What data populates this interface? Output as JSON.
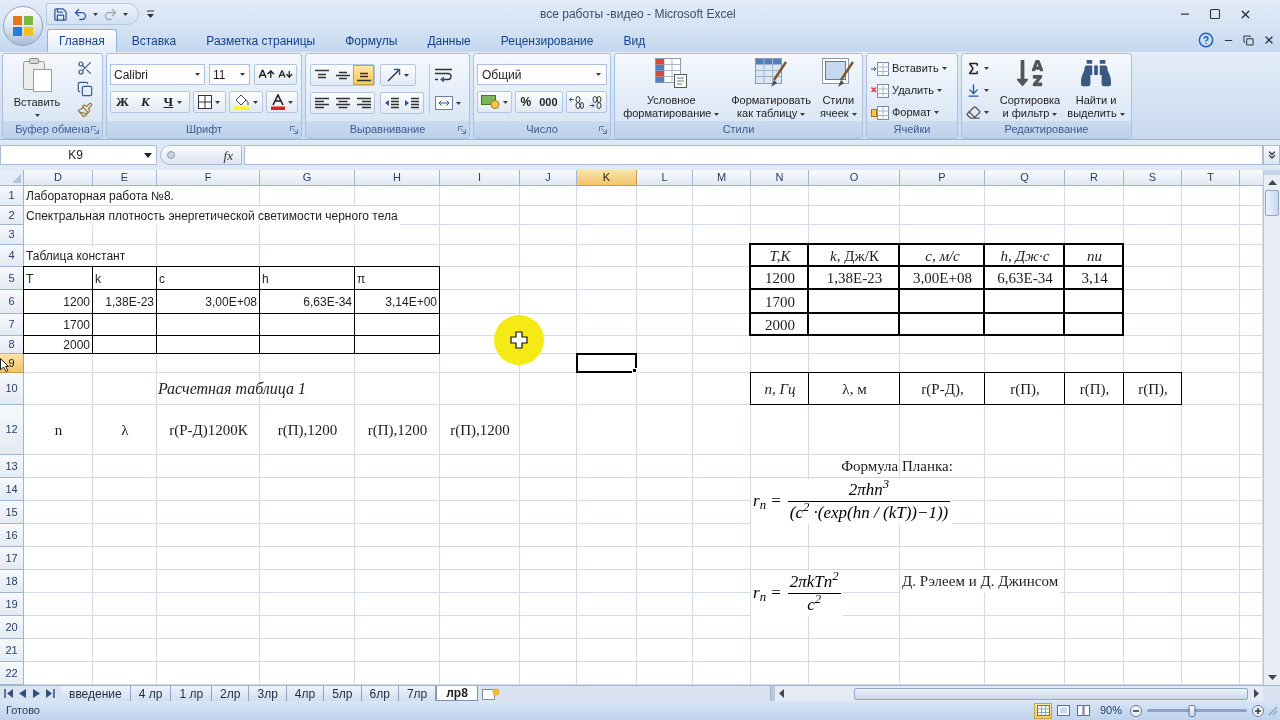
{
  "window": {
    "title": "все работы -видео - Microsoft Excel"
  },
  "ribbon": {
    "tabs": [
      {
        "label": "Главная",
        "selected": true
      },
      {
        "label": "Вставка",
        "selected": false
      },
      {
        "label": "Разметка страницы",
        "selected": false
      },
      {
        "label": "Формулы",
        "selected": false
      },
      {
        "label": "Данные",
        "selected": false
      },
      {
        "label": "Рецензирование",
        "selected": false
      },
      {
        "label": "Вид",
        "selected": false
      }
    ],
    "groups": [
      {
        "kind": "clipboard",
        "label": "Буфер обмена",
        "paste": "Вставить"
      },
      {
        "kind": "font",
        "label": "Шрифт",
        "font_name": "Calibri",
        "font_size": "11",
        "bold": "Ж",
        "italic": "К",
        "underline": "Ч"
      },
      {
        "kind": "alignment",
        "label": "Выравнивание",
        "vertical": [
          {
            "selected": false
          },
          {
            "selected": false
          },
          {
            "selected": true
          }
        ]
      },
      {
        "kind": "number",
        "label": "Число",
        "format": "Общий",
        "percent": "%",
        "thousands": "000"
      },
      {
        "kind": "styles",
        "label": "Стили",
        "buttons": [
          "Условное форматирование",
          "Форматировать как таблицу",
          "Стили ячеек"
        ]
      },
      {
        "kind": "cells",
        "label": "Ячейки",
        "buttons": [
          "Вставить",
          "Удалить",
          "Формат"
        ]
      },
      {
        "kind": "editing",
        "label": "Редактирование",
        "buttons": [
          "Сортировка и фильтр",
          "Найти и выделить"
        ]
      }
    ]
  },
  "formula_bar": {
    "name_box": "K9",
    "function_button": "fx"
  },
  "sheet": {
    "columns": [
      {
        "label": "D",
        "selected": false
      },
      {
        "label": "E",
        "selected": false
      },
      {
        "label": "F",
        "selected": false
      },
      {
        "label": "G",
        "selected": false
      },
      {
        "label": "H",
        "selected": false
      },
      {
        "label": "I",
        "selected": false
      },
      {
        "label": "J",
        "selected": false
      },
      {
        "label": "K",
        "selected": true
      },
      {
        "label": "L",
        "selected": false
      },
      {
        "label": "M",
        "selected": false
      },
      {
        "label": "N",
        "selected": false
      },
      {
        "label": "O",
        "selected": false
      },
      {
        "label": "P",
        "selected": false
      },
      {
        "label": "Q",
        "selected": false
      },
      {
        "label": "R",
        "selected": false
      },
      {
        "label": "S",
        "selected": false
      },
      {
        "label": "T",
        "selected": false
      }
    ],
    "rows": [
      {
        "label": "1",
        "selected": false
      },
      {
        "label": "2",
        "selected": false
      },
      {
        "label": "3",
        "selected": false
      },
      {
        "label": "4",
        "selected": false
      },
      {
        "label": "5",
        "selected": false
      },
      {
        "label": "6",
        "selected": false
      },
      {
        "label": "7",
        "selected": false
      },
      {
        "label": "8",
        "selected": false
      },
      {
        "label": "9",
        "selected": true
      },
      {
        "label": "10",
        "selected": false
      },
      {
        "label": "12",
        "selected": false
      },
      {
        "label": "13",
        "selected": false
      },
      {
        "label": "14",
        "selected": false
      },
      {
        "label": "15",
        "selected": false
      },
      {
        "label": "16",
        "selected": false
      },
      {
        "label": "17",
        "selected": false
      },
      {
        "label": "18",
        "selected": false
      },
      {
        "label": "19",
        "selected": false
      },
      {
        "label": "20",
        "selected": false
      },
      {
        "label": "21",
        "selected": false
      },
      {
        "label": "22",
        "selected": false
      }
    ],
    "heading": "Лабораторная работа №8.",
    "subtitle": "Спектральная плотность энергетической светимости черного тела",
    "constants_table": {
      "caption": "Таблица констант",
      "header": [
        "T",
        "k",
        "c",
        "h",
        "π"
      ],
      "rows": [
        [
          "1200",
          "1,38E-23",
          "3,00E+08",
          "6,63E-34",
          "3,14E+00"
        ],
        [
          "1700"
        ],
        [
          "2000"
        ]
      ]
    },
    "calc_table": {
      "caption": "Расчетная таблица 1",
      "header": [
        "n",
        "λ",
        "r(Р-Д)1200К",
        "r(П),1200",
        "r(П),1200",
        "r(П),1200"
      ]
    },
    "constants_table_2": {
      "header": [
        {
          "text": "T,K",
          "italic": true
        },
        {
          "text": "*k*,  Дж/К",
          "italic": false
        },
        {
          "text": "c, м/с",
          "italic": true
        },
        {
          "text": "h, Дж·с",
          "italic": true
        },
        {
          "text": "пи",
          "italic": true
        }
      ],
      "rows": [
        [
          "1200",
          "1,38E-23",
          "3,00E+08",
          "6,63E-34",
          "3,14"
        ],
        [
          "1700"
        ],
        [
          "2000"
        ]
      ]
    },
    "calc_table_2": {
      "header": [
        {
          "text": "n, Гц",
          "italic": true
        },
        {
          "text": "λ, м",
          "italic": false
        },
        {
          "text": "r(Р-Д),",
          "italic": false
        },
        {
          "text": "r(П),",
          "italic": false
        },
        {
          "text": "r(П),",
          "italic": false
        },
        {
          "text": "r(П),",
          "italic": false
        }
      ]
    },
    "planck": {
      "caption": "Формула Планка:",
      "lhs": "r$_{n}$ =",
      "numerator": "2πhn$^{3}$",
      "denominator": "(c$^{2}$ ·(exp(hn / (kT))−1))"
    },
    "rayleigh_jeans": {
      "lhs": "r$_{n}$ =",
      "numerator": "2πkTn$^{2}$",
      "denominator": "c$^{2}$",
      "caption": "Д. Рэлеем и Д. Джинсом"
    }
  },
  "sheet_tabs": [
    {
      "label": "введение",
      "selected": false
    },
    {
      "label": "4 лр",
      "selected": false
    },
    {
      "label": "1 лр",
      "selected": false
    },
    {
      "label": "2лр",
      "selected": false
    },
    {
      "label": "3лр",
      "selected": false
    },
    {
      "label": "4лр",
      "selected": false
    },
    {
      "label": "5лр",
      "selected": false
    },
    {
      "label": "6лр",
      "selected": false
    },
    {
      "label": "7лр",
      "selected": false
    },
    {
      "label": "лр8",
      "selected": true
    }
  ],
  "status_bar": {
    "status": "Готово",
    "views": [
      {
        "selected": true
      },
      {
        "selected": false
      },
      {
        "selected": false
      }
    ],
    "zoom": "90%",
    "zoom_slider": {
      "level": 0.45
    }
  }
}
